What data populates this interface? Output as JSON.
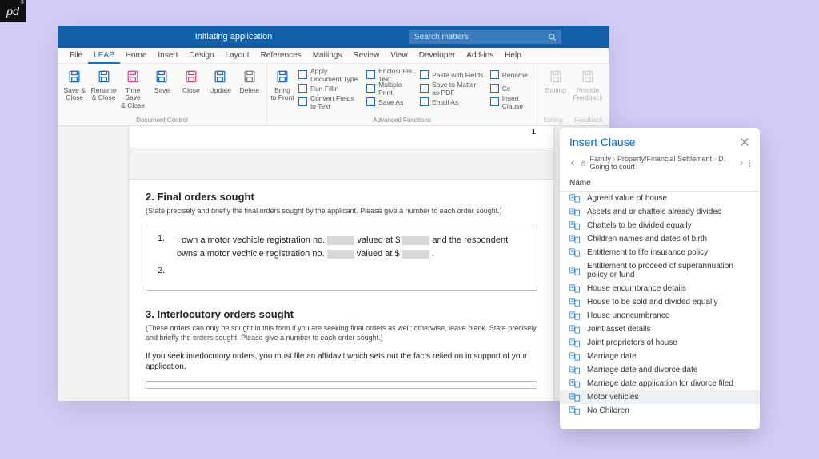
{
  "badge": "pd",
  "titlebar": {
    "title": "Initiating application",
    "search_placeholder": "Search matters"
  },
  "menubar": [
    "File",
    "LEAP",
    "Home",
    "Insert",
    "Design",
    "Layout",
    "References",
    "Mailings",
    "Review",
    "View",
    "Developer",
    "Add-ins",
    "Help"
  ],
  "menubar_active": 1,
  "ribbon": {
    "doc_control": {
      "label": "Document Control",
      "big": [
        {
          "name": "save-close",
          "label": "Save &\nClose"
        },
        {
          "name": "rename-close",
          "label": "Rename\n& Close"
        },
        {
          "name": "timesave-close",
          "label": "Time Save\n& Close"
        },
        {
          "name": "save",
          "label": "Save"
        },
        {
          "name": "close",
          "label": "Close"
        },
        {
          "name": "update",
          "label": "Update"
        },
        {
          "name": "delete",
          "label": "Delete"
        }
      ]
    },
    "adv": {
      "label": "Advanced Functions",
      "big": [
        {
          "name": "bring-front",
          "label": "Bring\nto Front"
        }
      ],
      "cols": [
        [
          "Apply Document Type",
          "Run Fillin",
          "Convert Fields to Text"
        ],
        [
          "Enclosures Text",
          "Multiple Print",
          "Save As"
        ],
        [
          "Paste with Fields",
          "Save to Matter as PDF",
          "Email As"
        ],
        [
          "Rename",
          "Cc",
          "Insert Clause"
        ]
      ]
    },
    "trailing": {
      "big": [
        {
          "name": "editing",
          "label": "Editing"
        },
        {
          "name": "provide-feedback",
          "label": "Provide\nFeedback"
        }
      ],
      "labels": [
        "Editing",
        "Feedback"
      ]
    }
  },
  "doc": {
    "page_num": "1",
    "sec2": {
      "heading": "2. Final orders sought",
      "note": "(State precisely and briefly the final orders sought by the applicant. Please give a number to each order sought.)",
      "item1_a": "I own a motor vechicle registration no.",
      "item1_b": "valued at $",
      "item1_c": "and the respondent",
      "item1_d": "owns a motor vechicle registration no.",
      "item1_e": "valued at $",
      "item1_f": "."
    },
    "sec3": {
      "heading": "3. Interlocutory orders sought",
      "note1": "(These orders can only be sought in this form if you are seeking final orders as well; otherwise, leave blank. State precisely and briefly the orders sought. Please give a number to each order sought.)",
      "note2": "If you seek interlocutory orders, you must file an affidavit which sets out the facts relied on in support of your application."
    }
  },
  "panel": {
    "title": "Insert Clause",
    "crumbs": [
      "Family",
      "Property/Financial Settlement",
      "D. Going to court"
    ],
    "col_header": "Name",
    "items": [
      "Agreed value of house",
      "Assets and or chattels already divided",
      "Chattels to be divided equally",
      "Children names and dates of birth",
      "Entitlement to life insurance policy",
      "Entitlement to proceed of superannuation policy or fund",
      "House encumbrance details",
      "House to be sold and divided equally",
      "House unencumbrance",
      "Joint asset details",
      "Joint proprietors of house",
      "Marriage date",
      "Marriage date and divorce date",
      "Marriage date application for divorce filed",
      "Motor vehicles",
      "No Children"
    ],
    "selected_index": 14
  }
}
